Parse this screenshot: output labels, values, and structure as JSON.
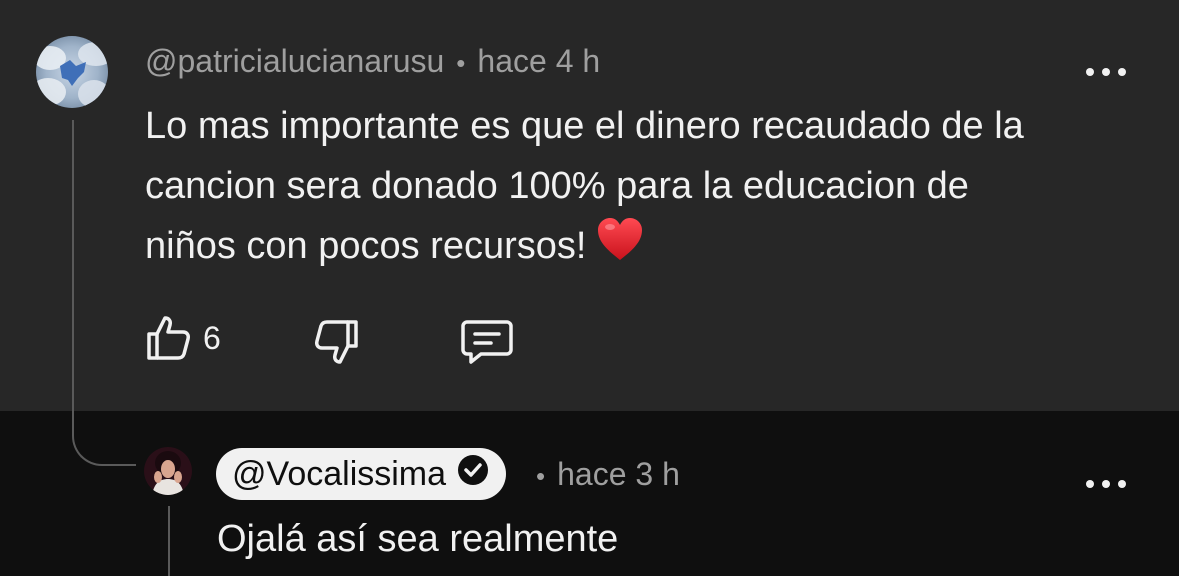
{
  "comment": {
    "author": "@patricialucianarusu",
    "separator": "•",
    "time": "hace 4 h",
    "text": "Lo mas importante es que el dinero recaudado de la cancion sera donado 100% para la educacion de niños con pocos recursos!",
    "emoji_icon": "red-heart",
    "like_count": "6",
    "menu_icon": "more-vertical-dots",
    "actions": [
      "like-icon",
      "dislike-icon",
      "reply-icon"
    ]
  },
  "reply": {
    "author": "@Vocalissima",
    "verified_icon": "verified-check",
    "separator": "•",
    "time": "hace 3 h",
    "text": "Ojalá así sea realmente",
    "menu_icon": "more-vertical-dots"
  },
  "colors": {
    "comment_bg": "#272727",
    "reply_bg": "#0f0f0f",
    "text": "#f1f1f1",
    "meta": "#9f9f9f",
    "heart": "#e0242f"
  }
}
